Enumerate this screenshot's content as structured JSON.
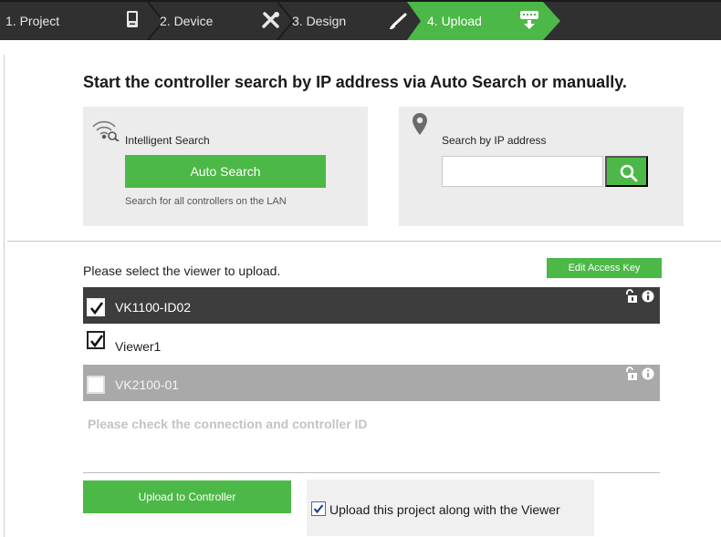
{
  "steps": {
    "project": "1. Project",
    "device": "2. Device",
    "design": "3. Design",
    "upload": "4. Upload",
    "active": "upload"
  },
  "heading": "Start the controller search by IP address via Auto Search or manually.",
  "intelligent_search": {
    "title": "Intelligent Search",
    "button": "Auto Search",
    "note": "Search for all controllers on the LAN",
    "icon": "wifi-search-icon"
  },
  "ip_search": {
    "title": "Search by IP address",
    "value": "",
    "placeholder": "",
    "icon": "location-pin-icon",
    "button_icon": "search-icon"
  },
  "viewer_list": {
    "label": "Please select the viewer to upload.",
    "edit_key_button": "Edit Access Key",
    "items": [
      {
        "name": "VK1100-ID02",
        "checked": true,
        "style": "dark",
        "icons": [
          "unlock-icon",
          "info-icon"
        ]
      },
      {
        "name": "Viewer1",
        "checked": true,
        "style": "plain",
        "icons": []
      },
      {
        "name": "VK2100-01",
        "checked": false,
        "style": "grey",
        "icons": [
          "unlock-icon",
          "info-icon"
        ]
      }
    ]
  },
  "connection_message": "Please check the connection and controller ID",
  "footer": {
    "upload_button": "Upload to Controller",
    "upload_with_viewer_label": "Upload this project along with the Viewer",
    "upload_with_viewer_checked": true
  },
  "colors": {
    "accent_green": "#4cb847",
    "stepper_bg": "#303030",
    "row_dark": "#3d3d3d",
    "row_grey": "#a9a9a9",
    "panel_bg": "#ececec"
  }
}
